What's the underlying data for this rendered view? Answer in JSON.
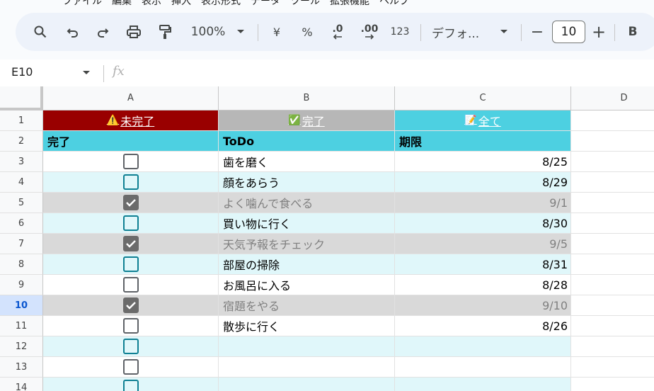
{
  "menu": [
    "ファイル",
    "編集",
    "表示",
    "挿入",
    "表示形式",
    "データ",
    "ツール",
    "拡張機能",
    "ヘルプ"
  ],
  "toolbar": {
    "zoom": "100%",
    "currency": "¥",
    "percent": "%",
    "dec_decrease": ".0",
    "dec_increase": ".00",
    "number_format": "123",
    "font_name": "デフォ...",
    "minus": "−",
    "font_size": "10",
    "plus": "+",
    "bold": "B"
  },
  "formula_bar": {
    "name_box": "E10",
    "fx": "fx"
  },
  "columns": [
    "A",
    "B",
    "C",
    "D"
  ],
  "rows": [
    "1",
    "2",
    "3",
    "4",
    "5",
    "6",
    "7",
    "8",
    "9",
    "10",
    "11",
    "12",
    "13",
    "14"
  ],
  "selected_row": "10",
  "filters": {
    "incomplete": "未完了",
    "done": "完了",
    "all": "全て",
    "incomplete_icon": "warning-icon",
    "done_icon": "check-icon",
    "all_icon": "memo-icon"
  },
  "headers": {
    "done": "完了",
    "todo": "ToDo",
    "deadline": "期限"
  },
  "tasks": [
    {
      "todo": "歯を磨く",
      "deadline": "8/25",
      "checked": false
    },
    {
      "todo": "顔をあらう",
      "deadline": "8/29",
      "checked": false
    },
    {
      "todo": "よく噛んで食べる",
      "deadline": "9/1",
      "checked": true
    },
    {
      "todo": "買い物に行く",
      "deadline": "8/30",
      "checked": false
    },
    {
      "todo": "天気予報をチェック",
      "deadline": "9/5",
      "checked": true
    },
    {
      "todo": "部屋の掃除",
      "deadline": "8/31",
      "checked": false
    },
    {
      "todo": "お風呂に入る",
      "deadline": "8/28",
      "checked": false
    },
    {
      "todo": "宿題をやる",
      "deadline": "9/10",
      "checked": true
    },
    {
      "todo": "散歩に行く",
      "deadline": "8/26",
      "checked": false
    },
    {
      "todo": "",
      "deadline": "",
      "checked": false
    },
    {
      "todo": "",
      "deadline": "",
      "checked": false
    },
    {
      "todo": "",
      "deadline": "",
      "checked": false
    }
  ],
  "colors": {
    "incomplete_bg": "#990000",
    "done_bg": "#b7b7b7",
    "all_bg": "#4dd0e1",
    "header_bg": "#4dd0e1",
    "band_bg": "#e0f7fa",
    "checked_bg": "#d9d9d9",
    "checked_text": "#808080"
  }
}
